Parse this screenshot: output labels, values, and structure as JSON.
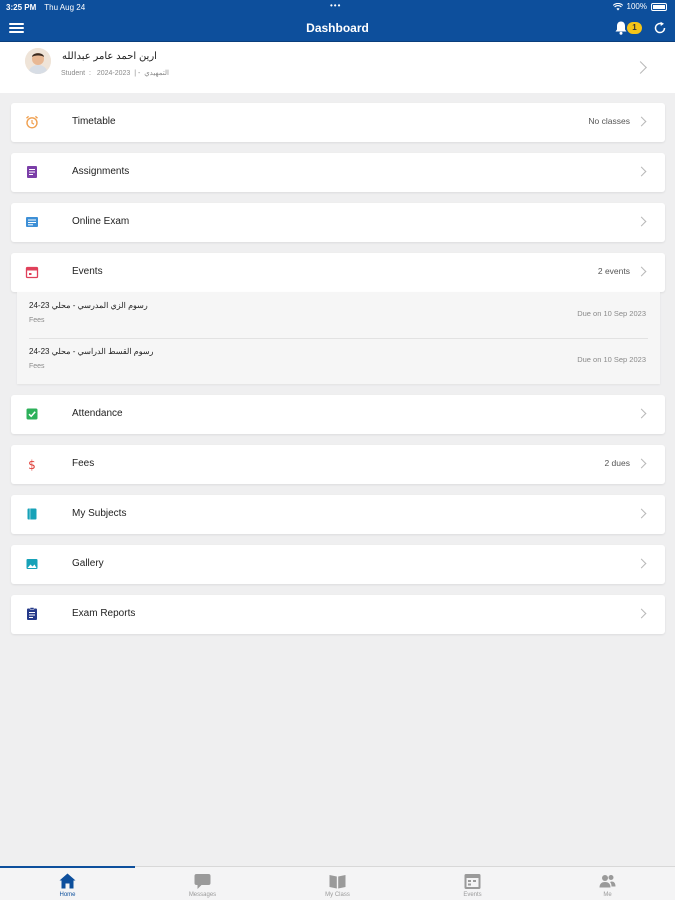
{
  "statusbar": {
    "time": "3:25 PM",
    "date": "Thu Aug 24",
    "dots": "•••",
    "battery": "100%"
  },
  "navbar": {
    "title": "Dashboard",
    "notification_count": "1"
  },
  "profile": {
    "name": "ارين احمد عامر عبدالله",
    "role": "Student",
    "year": "2024-2023",
    "grade": "التمهيدي"
  },
  "menu": {
    "timetable": {
      "label": "Timetable",
      "value": "No classes"
    },
    "assignments": {
      "label": "Assignments"
    },
    "online_exam": {
      "label": "Online Exam"
    },
    "events": {
      "label": "Events",
      "value": "2 events",
      "items": [
        {
          "name": "رسوم الزي المدرسي - محلي 23-24",
          "type": "Fees",
          "due": "Due on 10 Sep 2023"
        },
        {
          "name": "رسوم القسط الدراسي - محلي 23-24",
          "type": "Fees",
          "due": "Due on 10 Sep 2023"
        }
      ]
    },
    "attendance": {
      "label": "Attendance"
    },
    "fees": {
      "label": "Fees",
      "value": "2 dues"
    },
    "my_subjects": {
      "label": "My Subjects"
    },
    "gallery": {
      "label": "Gallery"
    },
    "exam_reports": {
      "label": "Exam Reports"
    }
  },
  "tabs": [
    {
      "label": "Home",
      "icon": "home-icon"
    },
    {
      "label": "Messages",
      "icon": "messages-icon"
    },
    {
      "label": "My Class",
      "icon": "book-icon"
    },
    {
      "label": "Events",
      "icon": "calendar-icon"
    },
    {
      "label": "Me",
      "icon": "people-icon"
    }
  ],
  "colors": {
    "brand": "#0d4f9c",
    "badge": "#f5c518",
    "background": "#efeff0"
  }
}
